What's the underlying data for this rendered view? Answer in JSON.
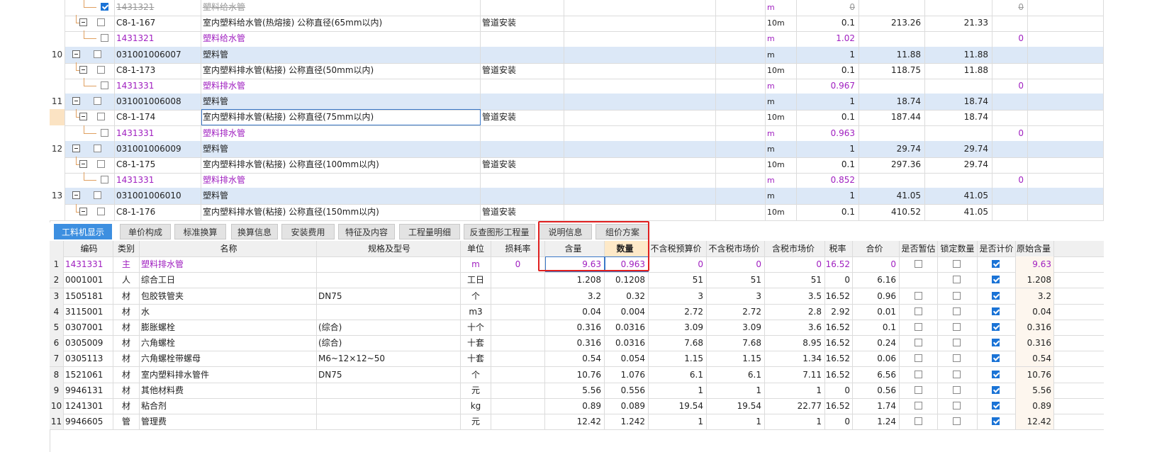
{
  "upper_grid": {
    "rows": [
      {
        "seq": "",
        "code": "1431321",
        "name": "塑料给水管",
        "prof": "",
        "unit": "m",
        "qty": "0",
        "price": "",
        "total": "",
        "v": "0",
        "kind": "material",
        "checked": true,
        "struck": true
      },
      {
        "seq": "",
        "code": "C8-1-167",
        "name": "室内塑料给水管(热熔接) 公称直径(65mm以内)",
        "prof": "管道安装",
        "unit": "10m",
        "qty": "0.1",
        "price": "213.26",
        "total": "21.33",
        "v": "",
        "kind": "quota",
        "checked": false,
        "struck": false
      },
      {
        "seq": "",
        "code": "1431321",
        "name": "塑料给水管",
        "prof": "",
        "unit": "m",
        "qty": "1.02",
        "price": "",
        "total": "",
        "v": "0",
        "kind": "material",
        "checked": false,
        "struck": false
      },
      {
        "seq": "10",
        "code": "031001006007",
        "name": "塑料管",
        "prof": "",
        "unit": "m",
        "qty": "1",
        "price": "11.88",
        "total": "11.88",
        "v": "",
        "kind": "item",
        "checked": false,
        "struck": false
      },
      {
        "seq": "",
        "code": "C8-1-173",
        "name": "室内塑料排水管(粘接) 公称直径(50mm以内)",
        "prof": "管道安装",
        "unit": "10m",
        "qty": "0.1",
        "price": "118.75",
        "total": "11.88",
        "v": "",
        "kind": "quota",
        "checked": false,
        "struck": false
      },
      {
        "seq": "",
        "code": "1431331",
        "name": "塑料排水管",
        "prof": "",
        "unit": "m",
        "qty": "0.967",
        "price": "",
        "total": "",
        "v": "0",
        "kind": "material",
        "checked": false,
        "struck": false
      },
      {
        "seq": "11",
        "code": "031001006008",
        "name": "塑料管",
        "prof": "",
        "unit": "m",
        "qty": "1",
        "price": "18.74",
        "total": "18.74",
        "v": "",
        "kind": "item",
        "checked": false,
        "struck": false
      },
      {
        "seq": "",
        "code": "C8-1-174",
        "name": "室内塑料排水管(粘接) 公称直径(75mm以内)",
        "prof": "管道安装",
        "unit": "10m",
        "qty": "0.1",
        "price": "187.44",
        "total": "18.74",
        "v": "",
        "kind": "quota",
        "checked": false,
        "struck": false,
        "selected": true
      },
      {
        "seq": "",
        "code": "1431331",
        "name": "塑料排水管",
        "prof": "",
        "unit": "m",
        "qty": "0.963",
        "price": "",
        "total": "",
        "v": "0",
        "kind": "material",
        "checked": false,
        "struck": false
      },
      {
        "seq": "12",
        "code": "031001006009",
        "name": "塑料管",
        "prof": "",
        "unit": "m",
        "qty": "1",
        "price": "29.74",
        "total": "29.74",
        "v": "",
        "kind": "item",
        "checked": false,
        "struck": false
      },
      {
        "seq": "",
        "code": "C8-1-175",
        "name": "室内塑料排水管(粘接) 公称直径(100mm以内)",
        "prof": "管道安装",
        "unit": "10m",
        "qty": "0.1",
        "price": "297.36",
        "total": "29.74",
        "v": "",
        "kind": "quota",
        "checked": false,
        "struck": false
      },
      {
        "seq": "",
        "code": "1431331",
        "name": "塑料排水管",
        "prof": "",
        "unit": "m",
        "qty": "0.852",
        "price": "",
        "total": "",
        "v": "0",
        "kind": "material",
        "checked": false,
        "struck": false
      },
      {
        "seq": "13",
        "code": "031001006010",
        "name": "塑料管",
        "prof": "",
        "unit": "m",
        "qty": "1",
        "price": "41.05",
        "total": "41.05",
        "v": "",
        "kind": "item",
        "checked": false,
        "struck": false
      },
      {
        "seq": "",
        "code": "C8-1-176",
        "name": "室内塑料排水管(粘接) 公称直径(150mm以内)",
        "prof": "管道安装",
        "unit": "10m",
        "qty": "0.1",
        "price": "410.52",
        "total": "41.05",
        "v": "",
        "kind": "quota",
        "checked": false,
        "struck": false
      }
    ]
  },
  "tabs": [
    "工料机显示",
    "单价构成",
    "标准换算",
    "换算信息",
    "安装费用",
    "特征及内容",
    "工程量明细",
    "反查图形工程量",
    "说明信息",
    "组价方案"
  ],
  "active_tab": 0,
  "lower_grid": {
    "headers": {
      "code": "编码",
      "type": "类别",
      "name": "名称",
      "spec": "规格及型号",
      "unit": "单位",
      "loss": "损耗率",
      "content": "含量",
      "qty": "数量",
      "bp": "不含税预算价",
      "bm": "不含税市场价",
      "tm": "含税市场价",
      "tax": "税率",
      "sum": "合价",
      "est": "是否暂估",
      "lock": "锁定数量",
      "calc": "是否计价",
      "orig": "原始含量"
    },
    "rows": [
      {
        "seq": "1",
        "code": "1431331",
        "type": "主",
        "name": "塑料排水管",
        "spec": "",
        "unit": "m",
        "loss": "0",
        "content": "9.63",
        "qty": "0.963",
        "bp": "0",
        "bm": "0",
        "tm": "0",
        "tax": "16.52",
        "sum": "0",
        "est": false,
        "lock": false,
        "calc": true,
        "orig": "9.63"
      },
      {
        "seq": "2",
        "code": "0001001",
        "type": "人",
        "name": "综合工日",
        "spec": "",
        "unit": "工日",
        "loss": "",
        "content": "1.208",
        "qty": "0.1208",
        "bp": "51",
        "bm": "51",
        "tm": "51",
        "tax": "0",
        "sum": "6.16",
        "est": null,
        "lock": false,
        "calc": true,
        "orig": "1.208"
      },
      {
        "seq": "3",
        "code": "1505181",
        "type": "材",
        "name": "包胶铁管夹",
        "spec": "DN75",
        "unit": "个",
        "loss": "",
        "content": "3.2",
        "qty": "0.32",
        "bp": "3",
        "bm": "3",
        "tm": "3.5",
        "tax": "16.52",
        "sum": "0.96",
        "est": false,
        "lock": false,
        "calc": true,
        "orig": "3.2"
      },
      {
        "seq": "4",
        "code": "3115001",
        "type": "材",
        "name": "水",
        "spec": "",
        "unit": "m3",
        "loss": "",
        "content": "0.04",
        "qty": "0.004",
        "bp": "2.72",
        "bm": "2.72",
        "tm": "2.8",
        "tax": "2.92",
        "sum": "0.01",
        "est": false,
        "lock": false,
        "calc": true,
        "orig": "0.04"
      },
      {
        "seq": "5",
        "code": "0307001",
        "type": "材",
        "name": "膨胀螺栓",
        "spec": "(综合)",
        "unit": "十个",
        "loss": "",
        "content": "0.316",
        "qty": "0.0316",
        "bp": "3.09",
        "bm": "3.09",
        "tm": "3.6",
        "tax": "16.52",
        "sum": "0.1",
        "est": false,
        "lock": false,
        "calc": true,
        "orig": "0.316"
      },
      {
        "seq": "6",
        "code": "0305009",
        "type": "材",
        "name": "六角螺栓",
        "spec": "(综合)",
        "unit": "十套",
        "loss": "",
        "content": "0.316",
        "qty": "0.0316",
        "bp": "7.68",
        "bm": "7.68",
        "tm": "8.95",
        "tax": "16.52",
        "sum": "0.24",
        "est": false,
        "lock": false,
        "calc": true,
        "orig": "0.316"
      },
      {
        "seq": "7",
        "code": "0305113",
        "type": "材",
        "name": "六角螺栓带螺母",
        "spec": "M6~12×12~50",
        "unit": "十套",
        "loss": "",
        "content": "0.54",
        "qty": "0.054",
        "bp": "1.15",
        "bm": "1.15",
        "tm": "1.34",
        "tax": "16.52",
        "sum": "0.06",
        "est": false,
        "lock": false,
        "calc": true,
        "orig": "0.54"
      },
      {
        "seq": "8",
        "code": "1521061",
        "type": "材",
        "name": "室内塑料排水管件",
        "spec": "DN75",
        "unit": "个",
        "loss": "",
        "content": "10.76",
        "qty": "1.076",
        "bp": "6.1",
        "bm": "6.1",
        "tm": "7.11",
        "tax": "16.52",
        "sum": "6.56",
        "est": false,
        "lock": false,
        "calc": true,
        "orig": "10.76"
      },
      {
        "seq": "9",
        "code": "9946131",
        "type": "材",
        "name": "其他材料费",
        "spec": "",
        "unit": "元",
        "loss": "",
        "content": "5.56",
        "qty": "0.556",
        "bp": "1",
        "bm": "1",
        "tm": "1",
        "tax": "0",
        "sum": "0.56",
        "est": false,
        "lock": false,
        "calc": true,
        "orig": "5.56"
      },
      {
        "seq": "10",
        "code": "1241301",
        "type": "材",
        "name": "粘合剂",
        "spec": "",
        "unit": "kg",
        "loss": "",
        "content": "0.89",
        "qty": "0.089",
        "bp": "19.54",
        "bm": "19.54",
        "tm": "22.77",
        "tax": "16.52",
        "sum": "1.74",
        "est": false,
        "lock": false,
        "calc": true,
        "orig": "0.89"
      },
      {
        "seq": "11",
        "code": "9946605",
        "type": "管",
        "name": "管理费",
        "spec": "",
        "unit": "元",
        "loss": "",
        "content": "12.42",
        "qty": "1.242",
        "bp": "1",
        "bm": "1",
        "tm": "1",
        "tax": "0",
        "sum": "1.24",
        "est": false,
        "lock": false,
        "calc": true,
        "orig": "12.42"
      }
    ]
  },
  "colors": {
    "accent": "#3d8fe0",
    "highlight_box": "#e02020",
    "material_text": "#a020c0",
    "item_row_bg": "#dce8f7"
  }
}
